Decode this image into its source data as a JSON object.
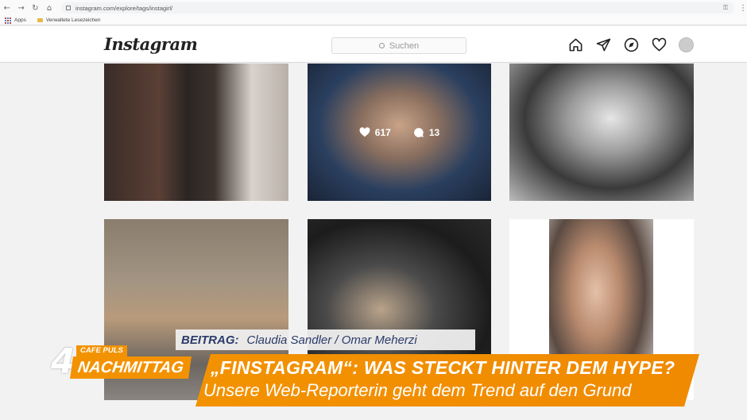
{
  "browser": {
    "url": "instagram.com/explore/tags/instagirl/",
    "bookmarks": {
      "apps_label": "Apps",
      "folder_label": "Verwaltete Lesezeichen"
    }
  },
  "instagram": {
    "logo": "Instagram",
    "search_placeholder": "Suchen",
    "hover_post": {
      "likes": "617",
      "comments": "13"
    }
  },
  "tv": {
    "credit_label": "BEITRAG:",
    "credit_names": "Claudia Sandler / Omar Meherzi",
    "show_number": "4",
    "show_brand": "CAFE PULS",
    "show_name": "NACHMITTAG",
    "headline": "„FINSTAGRAM“: WAS STECKT HINTER DEM HYPE?",
    "subline": "Unsere Web-Reporterin geht dem Trend auf den Grund"
  },
  "colors": {
    "accent_orange": "#f39200",
    "credit_text": "#2b3b6a"
  }
}
